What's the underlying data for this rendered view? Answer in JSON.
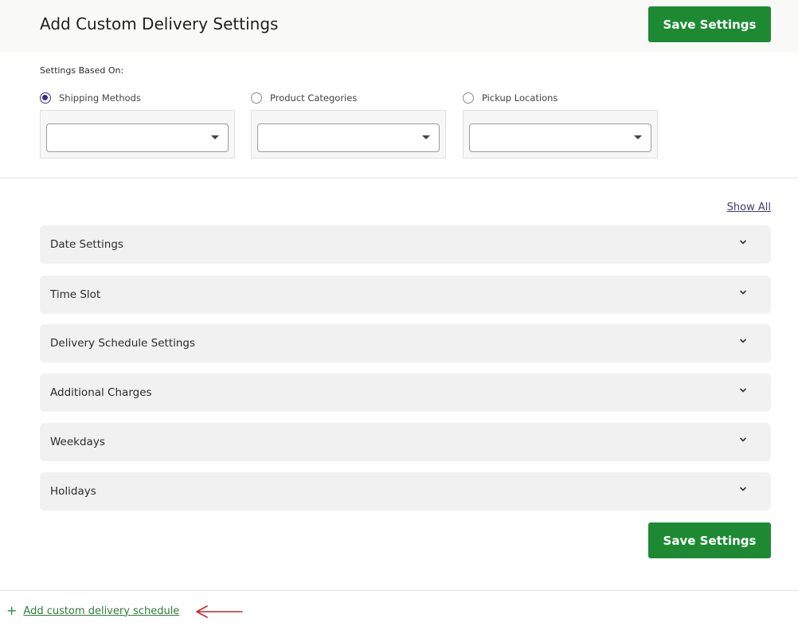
{
  "header": {
    "title": "Add Custom Delivery Settings",
    "save_label": "Save Settings"
  },
  "settings_based_on": {
    "label": "Settings Based On:",
    "options": [
      {
        "label": "Shipping Methods",
        "checked": true
      },
      {
        "label": "Product Categories",
        "checked": false
      },
      {
        "label": "Pickup Locations",
        "checked": false
      }
    ]
  },
  "show_all_label": "Show All",
  "sections": [
    {
      "label": "Date Settings"
    },
    {
      "label": "Time Slot"
    },
    {
      "label": "Delivery Schedule Settings"
    },
    {
      "label": "Additional Charges"
    },
    {
      "label": "Weekdays"
    },
    {
      "label": "Holidays"
    }
  ],
  "footer": {
    "save_label": "Save Settings",
    "add_schedule_label": "Add custom delivery schedule"
  },
  "colors": {
    "primary_button": "#1d8a33",
    "radio_checked": "#3b2b8c",
    "annotation_arrow": "#c0282e",
    "link_green": "#2e7d3a"
  }
}
